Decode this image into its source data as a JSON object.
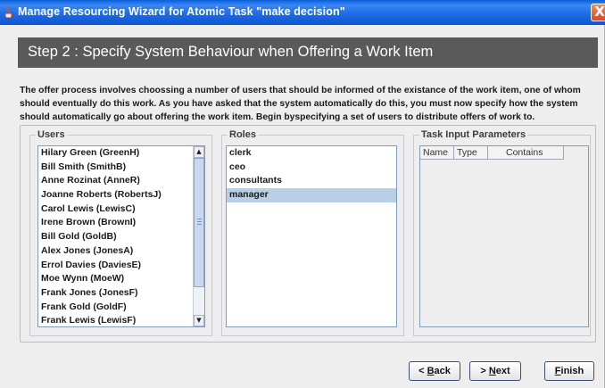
{
  "window": {
    "title": "Manage Resourcing Wizard for Atomic Task \"make decision\"",
    "accent": "#1f6ce6",
    "close_symbol": "X"
  },
  "step": {
    "title": "Step 2 : Specify System Behaviour when Offering a Work Item"
  },
  "description": "The offer process involves choossing a number of users that should be informed of the existance of the work item, one of whom should eventually do this work. As you have asked that the system automatically do this, you must now specify how the system should automatically go about offering the work item. Begin byspecifying a set of users to distribute offers of work to.",
  "users": {
    "title": "Users",
    "items": [
      "Hilary Green (GreenH)",
      "Bill Smith (SmithB)",
      "Anne Rozinat (AnneR)",
      "Joanne Roberts (RobertsJ)",
      "Carol Lewis (LewisC)",
      "Irene Brown (BrownI)",
      "Bill Gold (GoldB)",
      "Alex Jones (JonesA)",
      "Errol Davies (DaviesE)",
      "Moe Wynn (MoeW)",
      "Frank Jones (JonesF)",
      "Frank Gold (GoldF)",
      "Frank Lewis (LewisF)"
    ]
  },
  "roles": {
    "title": "Roles",
    "items": [
      "clerk",
      "ceo",
      "consultants",
      "manager"
    ],
    "selected": "manager",
    "selected_color": "#b8cfe5"
  },
  "params": {
    "title": "Task Input Parameters",
    "columns": [
      "Name",
      "Type",
      "Contains"
    ]
  },
  "buttons": {
    "back": {
      "mnemonic": "B",
      "rest": "ack",
      "prefix": "< "
    },
    "next": {
      "prefix": "> ",
      "mnemonic": "N",
      "rest": "ext"
    },
    "finish": {
      "mnemonic": "F",
      "rest": "inish"
    }
  }
}
